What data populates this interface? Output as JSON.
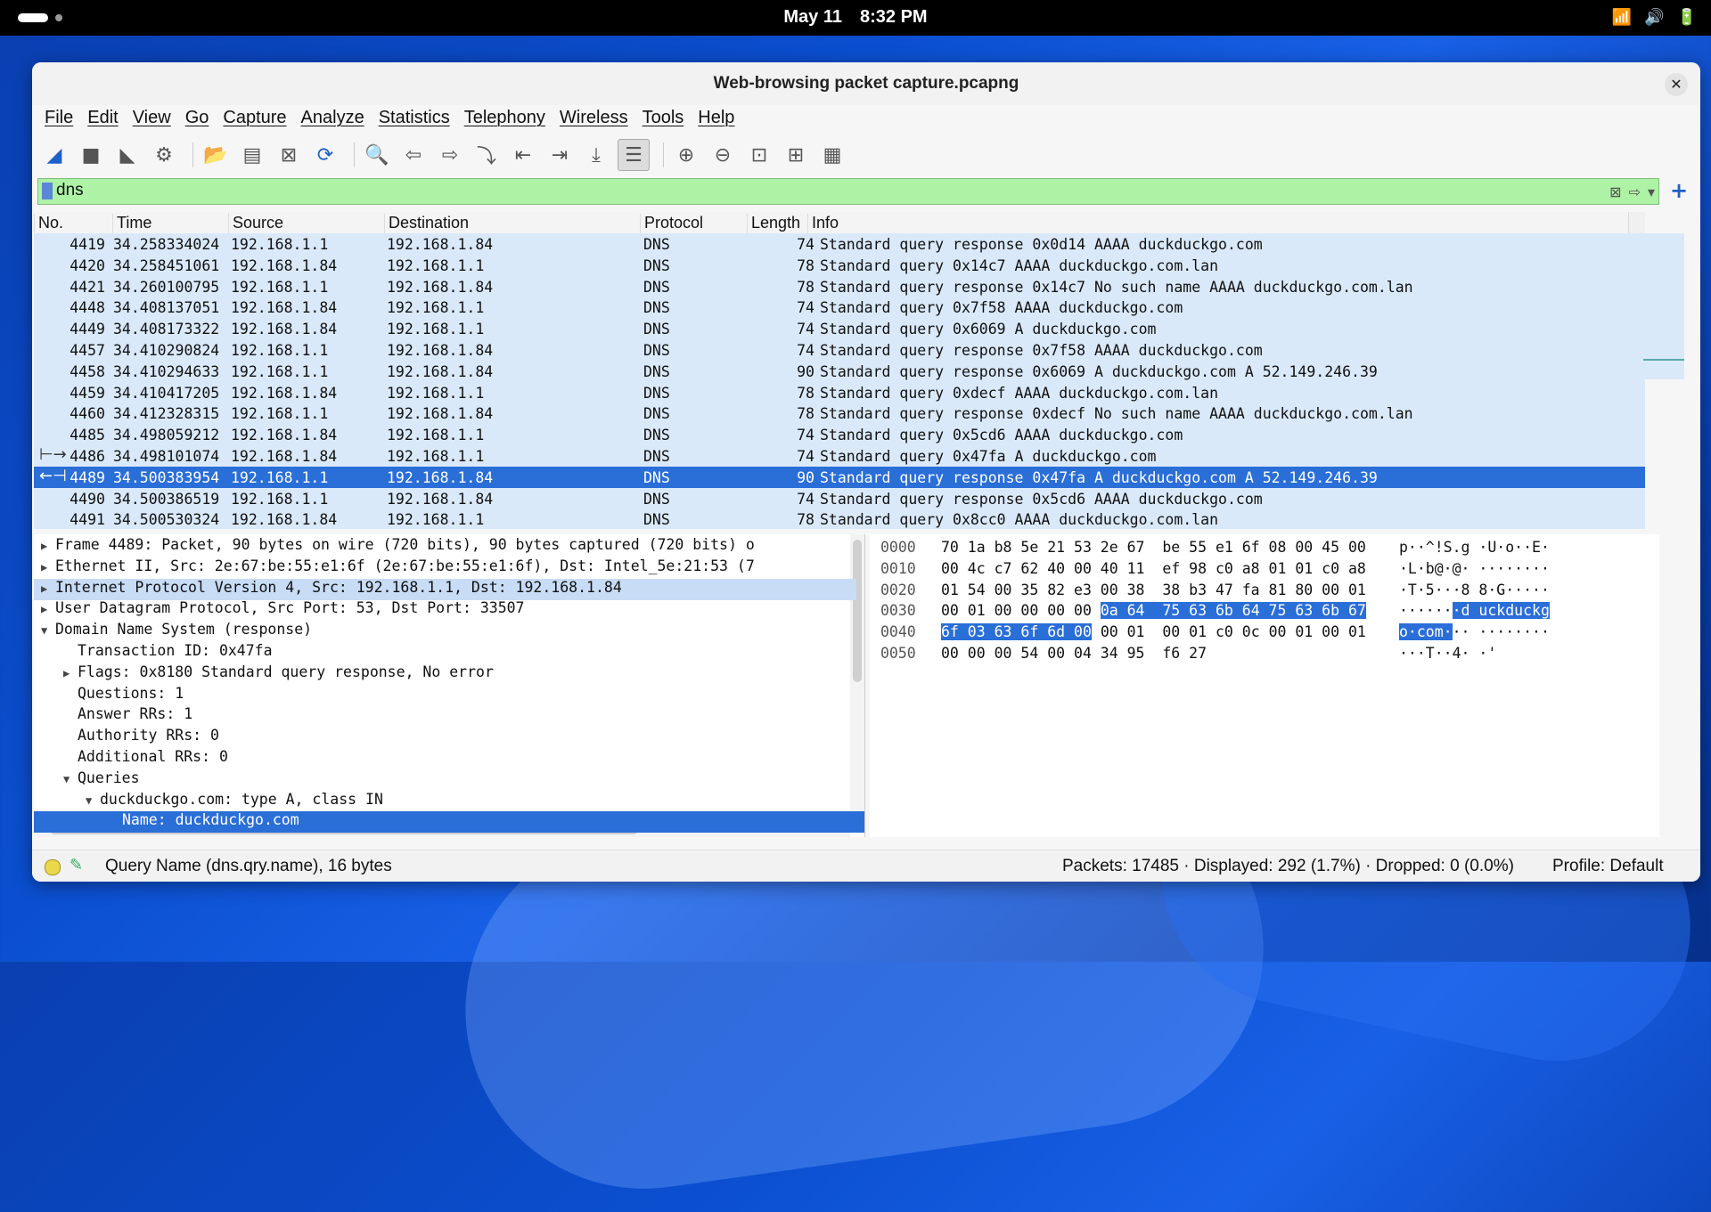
{
  "system": {
    "date": "May 11",
    "time": "8:32 PM"
  },
  "window": {
    "title": "Web-browsing packet capture.pcapng"
  },
  "menu": [
    "File",
    "Edit",
    "View",
    "Go",
    "Capture",
    "Analyze",
    "Statistics",
    "Telephony",
    "Wireless",
    "Tools",
    "Help"
  ],
  "filter": {
    "value": "dns"
  },
  "columns": {
    "no": "No.",
    "time": "Time",
    "source": "Source",
    "destination": "Destination",
    "protocol": "Protocol",
    "length": "Length",
    "info": "Info"
  },
  "packets": [
    {
      "no": "4419",
      "time": "34.258334024",
      "src": "192.168.1.1",
      "dst": "192.168.1.84",
      "proto": "DNS",
      "len": "74",
      "info": "Standard query response 0x0d14 AAAA duckduckgo.com"
    },
    {
      "no": "4420",
      "time": "34.258451061",
      "src": "192.168.1.84",
      "dst": "192.168.1.1",
      "proto": "DNS",
      "len": "78",
      "info": "Standard query 0x14c7 AAAA duckduckgo.com.lan"
    },
    {
      "no": "4421",
      "time": "34.260100795",
      "src": "192.168.1.1",
      "dst": "192.168.1.84",
      "proto": "DNS",
      "len": "78",
      "info": "Standard query response 0x14c7 No such name AAAA duckduckgo.com.lan"
    },
    {
      "no": "4448",
      "time": "34.408137051",
      "src": "192.168.1.84",
      "dst": "192.168.1.1",
      "proto": "DNS",
      "len": "74",
      "info": "Standard query 0x7f58 AAAA duckduckgo.com"
    },
    {
      "no": "4449",
      "time": "34.408173322",
      "src": "192.168.1.84",
      "dst": "192.168.1.1",
      "proto": "DNS",
      "len": "74",
      "info": "Standard query 0x6069 A duckduckgo.com"
    },
    {
      "no": "4457",
      "time": "34.410290824",
      "src": "192.168.1.1",
      "dst": "192.168.1.84",
      "proto": "DNS",
      "len": "74",
      "info": "Standard query response 0x7f58 AAAA duckduckgo.com"
    },
    {
      "no": "4458",
      "time": "34.410294633",
      "src": "192.168.1.1",
      "dst": "192.168.1.84",
      "proto": "DNS",
      "len": "90",
      "info": "Standard query response 0x6069 A duckduckgo.com A 52.149.246.39"
    },
    {
      "no": "4459",
      "time": "34.410417205",
      "src": "192.168.1.84",
      "dst": "192.168.1.1",
      "proto": "DNS",
      "len": "78",
      "info": "Standard query 0xdecf AAAA duckduckgo.com.lan"
    },
    {
      "no": "4460",
      "time": "34.412328315",
      "src": "192.168.1.1",
      "dst": "192.168.1.84",
      "proto": "DNS",
      "len": "78",
      "info": "Standard query response 0xdecf No such name AAAA duckduckgo.com.lan"
    },
    {
      "no": "4485",
      "time": "34.498059212",
      "src": "192.168.1.84",
      "dst": "192.168.1.1",
      "proto": "DNS",
      "len": "74",
      "info": "Standard query 0x5cd6 AAAA duckduckgo.com"
    },
    {
      "no": "4486",
      "time": "34.498101074",
      "src": "192.168.1.84",
      "dst": "192.168.1.1",
      "proto": "DNS",
      "len": "74",
      "info": "Standard query 0x47fa A duckduckgo.com"
    },
    {
      "no": "4489",
      "time": "34.500383954",
      "src": "192.168.1.1",
      "dst": "192.168.1.84",
      "proto": "DNS",
      "len": "90",
      "info": "Standard query response 0x47fa A duckduckgo.com A 52.149.246.39",
      "selected": true
    },
    {
      "no": "4490",
      "time": "34.500386519",
      "src": "192.168.1.1",
      "dst": "192.168.1.84",
      "proto": "DNS",
      "len": "74",
      "info": "Standard query response 0x5cd6 AAAA duckduckgo.com"
    },
    {
      "no": "4491",
      "time": "34.500530324",
      "src": "192.168.1.84",
      "dst": "192.168.1.1",
      "proto": "DNS",
      "len": "78",
      "info": "Standard query 0x8cc0 AAAA duckduckgo.com.lan"
    }
  ],
  "details": [
    {
      "indent": 0,
      "arrow": "right",
      "text": "Frame 4489: Packet, 90 bytes on wire (720 bits), 90 bytes captured (720 bits) o"
    },
    {
      "indent": 0,
      "arrow": "right",
      "text": "Ethernet II, Src: 2e:67:be:55:e1:6f (2e:67:be:55:e1:6f), Dst: Intel_5e:21:53 (7"
    },
    {
      "indent": 0,
      "arrow": "right",
      "text": "Internet Protocol Version 4, Src: 192.168.1.1, Dst: 192.168.1.84",
      "state": "hl"
    },
    {
      "indent": 0,
      "arrow": "right",
      "text": "User Datagram Protocol, Src Port: 53, Dst Port: 33507"
    },
    {
      "indent": 0,
      "arrow": "down",
      "text": "Domain Name System (response)"
    },
    {
      "indent": 1,
      "arrow": "",
      "text": "Transaction ID: 0x47fa"
    },
    {
      "indent": 1,
      "arrow": "right",
      "text": "Flags: 0x8180 Standard query response, No error"
    },
    {
      "indent": 1,
      "arrow": "",
      "text": "Questions: 1"
    },
    {
      "indent": 1,
      "arrow": "",
      "text": "Answer RRs: 1"
    },
    {
      "indent": 1,
      "arrow": "",
      "text": "Authority RRs: 0"
    },
    {
      "indent": 1,
      "arrow": "",
      "text": "Additional RRs: 0"
    },
    {
      "indent": 1,
      "arrow": "down",
      "text": "Queries"
    },
    {
      "indent": 2,
      "arrow": "down",
      "text": "duckduckgo.com: type A, class IN"
    },
    {
      "indent": 3,
      "arrow": "",
      "text": "Name: duckduckgo.com",
      "state": "sel"
    }
  ],
  "hex": [
    {
      "offset": "0000",
      "pre": "70 1a b8 5e 21 53 2e 67  be 55 e1 6f 08 00 45 00",
      "sel": "",
      "post": "",
      "apre": "p··^!S.g ·U·o··E·",
      "asel": "",
      "apost": ""
    },
    {
      "offset": "0010",
      "pre": "00 4c c7 62 40 00 40 11  ef 98 c0 a8 01 01 c0 a8",
      "sel": "",
      "post": "",
      "apre": "·L·b@·@· ········",
      "asel": "",
      "apost": ""
    },
    {
      "offset": "0020",
      "pre": "01 54 00 35 82 e3 00 38  38 b3 47 fa 81 80 00 01",
      "sel": "",
      "post": "",
      "apre": "·T·5···8 8·G·····",
      "asel": "",
      "apost": ""
    },
    {
      "offset": "0030",
      "pre": "00 01 00 00 00 00 ",
      "sel": "0a 64  75 63 6b 64 75 63 6b 67",
      "post": "",
      "apre": "······",
      "asel": "·d uckduckg",
      "apost": ""
    },
    {
      "offset": "0040",
      "pre": "",
      "sel": "6f 03 63 6f 6d 00",
      "post": " 00 01  00 01 c0 0c 00 01 00 01",
      "apre": "",
      "asel": "o·com·",
      "apost": "·· ········"
    },
    {
      "offset": "0050",
      "pre": "00 00 00 54 00 04 34 95  f6 27",
      "sel": "",
      "post": "",
      "apre": "···T··4· ·'",
      "asel": "",
      "apost": ""
    }
  ],
  "status": {
    "message": "Query Name (dns.qry.name), 16 bytes",
    "stats": "Packets: 17485 · Displayed: 292 (1.7%) · Dropped: 0 (0.0%)",
    "profile": "Profile: Default"
  },
  "colors": {
    "selection": "#2a6ed8",
    "row_bg": "#dae9f9",
    "filter_bg": "#aef2a6"
  }
}
